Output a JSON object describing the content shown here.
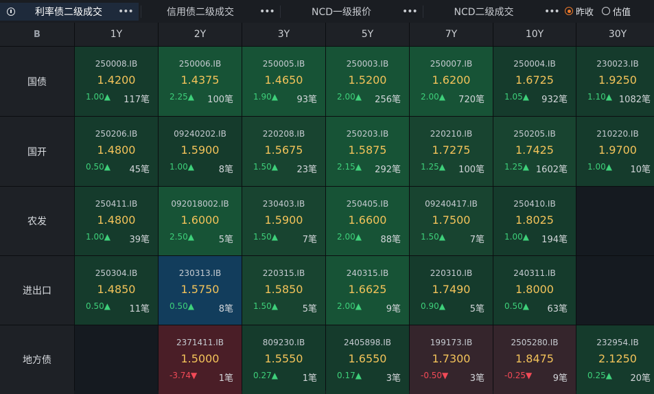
{
  "tabs": [
    {
      "label": "利率债二级成交",
      "active": true
    },
    {
      "label": "信用债二级成交",
      "active": false
    },
    {
      "label": "NCD一级报价",
      "active": false
    },
    {
      "label": "NCD二级成交",
      "active": false
    }
  ],
  "more_glyph": "•••",
  "radio": {
    "options": [
      {
        "label": "昨收",
        "checked": true
      },
      {
        "label": "估值",
        "checked": false
      }
    ]
  },
  "corner_icon": "B",
  "columns": [
    "1Y",
    "2Y",
    "3Y",
    "5Y",
    "7Y",
    "10Y",
    "30Y"
  ],
  "rows": [
    {
      "label": "国债",
      "cells": [
        {
          "code": "250008.IB",
          "yield": "1.4200",
          "change": "1.00▲",
          "dir": "up",
          "count": "117笔",
          "tone": "green-dark"
        },
        {
          "code": "250006.IB",
          "yield": "1.4375",
          "change": "2.25▲",
          "dir": "up",
          "count": "100笔",
          "tone": "green"
        },
        {
          "code": "250005.IB",
          "yield": "1.4650",
          "change": "1.90▲",
          "dir": "up",
          "count": "93笔",
          "tone": "green"
        },
        {
          "code": "250003.IB",
          "yield": "1.5200",
          "change": "2.00▲",
          "dir": "up",
          "count": "256笔",
          "tone": "green"
        },
        {
          "code": "250007.IB",
          "yield": "1.6200",
          "change": "2.00▲",
          "dir": "up",
          "count": "720笔",
          "tone": "green"
        },
        {
          "code": "250004.IB",
          "yield": "1.6725",
          "change": "1.05▲",
          "dir": "up",
          "count": "932笔",
          "tone": "green-dark"
        },
        {
          "code": "230023.IB",
          "yield": "1.9250",
          "change": "1.10▲",
          "dir": "up",
          "count": "1082笔",
          "tone": "green-dark"
        }
      ]
    },
    {
      "label": "国开",
      "cells": [
        {
          "code": "250206.IB",
          "yield": "1.4800",
          "change": "0.50▲",
          "dir": "up",
          "count": "45笔",
          "tone": "green-dark"
        },
        {
          "code": "09240202.IB",
          "yield": "1.5900",
          "change": "1.00▲",
          "dir": "up",
          "count": "8笔",
          "tone": "green-dark"
        },
        {
          "code": "220208.IB",
          "yield": "1.5675",
          "change": "1.50▲",
          "dir": "up",
          "count": "23笔",
          "tone": "green-mid"
        },
        {
          "code": "250203.IB",
          "yield": "1.5875",
          "change": "2.15▲",
          "dir": "up",
          "count": "292笔",
          "tone": "green"
        },
        {
          "code": "220210.IB",
          "yield": "1.7275",
          "change": "1.25▲",
          "dir": "up",
          "count": "100笔",
          "tone": "green-mid"
        },
        {
          "code": "250205.IB",
          "yield": "1.7425",
          "change": "1.25▲",
          "dir": "up",
          "count": "1602笔",
          "tone": "green-mid"
        },
        {
          "code": "210220.IB",
          "yield": "1.9700",
          "change": "1.00▲",
          "dir": "up",
          "count": "10笔",
          "tone": "green-dark"
        }
      ]
    },
    {
      "label": "农发",
      "cells": [
        {
          "code": "250411.IB",
          "yield": "1.4800",
          "change": "1.00▲",
          "dir": "up",
          "count": "39笔",
          "tone": "green-dark"
        },
        {
          "code": "092018002.IB",
          "yield": "1.6000",
          "change": "2.50▲",
          "dir": "up",
          "count": "5笔",
          "tone": "green"
        },
        {
          "code": "230403.IB",
          "yield": "1.5900",
          "change": "1.50▲",
          "dir": "up",
          "count": "7笔",
          "tone": "green-mid"
        },
        {
          "code": "250405.IB",
          "yield": "1.6600",
          "change": "2.00▲",
          "dir": "up",
          "count": "88笔",
          "tone": "green"
        },
        {
          "code": "09240417.IB",
          "yield": "1.7500",
          "change": "1.50▲",
          "dir": "up",
          "count": "7笔",
          "tone": "green-mid"
        },
        {
          "code": "250410.IB",
          "yield": "1.8025",
          "change": "1.00▲",
          "dir": "up",
          "count": "194笔",
          "tone": "green-dark"
        },
        null
      ]
    },
    {
      "label": "进出口",
      "cells": [
        {
          "code": "250304.IB",
          "yield": "1.4850",
          "change": "0.50▲",
          "dir": "up",
          "count": "11笔",
          "tone": "green-dark"
        },
        {
          "code": "230313.IB",
          "yield": "1.5750",
          "change": "0.50▲",
          "dir": "up",
          "count": "8笔",
          "tone": "blue"
        },
        {
          "code": "220315.IB",
          "yield": "1.5850",
          "change": "1.50▲",
          "dir": "up",
          "count": "5笔",
          "tone": "green-mid"
        },
        {
          "code": "240315.IB",
          "yield": "1.6625",
          "change": "2.00▲",
          "dir": "up",
          "count": "9笔",
          "tone": "green"
        },
        {
          "code": "220310.IB",
          "yield": "1.7490",
          "change": "0.90▲",
          "dir": "up",
          "count": "5笔",
          "tone": "green-dark"
        },
        {
          "code": "240311.IB",
          "yield": "1.8000",
          "change": "0.50▲",
          "dir": "up",
          "count": "63笔",
          "tone": "green-dark"
        },
        null
      ]
    },
    {
      "label": "地方债",
      "cells": [
        null,
        {
          "code": "2371411.IB",
          "yield": "1.5000",
          "change": "-3.74▼",
          "dir": "down",
          "count": "1笔",
          "tone": "red"
        },
        {
          "code": "809230.IB",
          "yield": "1.5550",
          "change": "0.27▲",
          "dir": "up",
          "count": "1笔",
          "tone": "green-dark"
        },
        {
          "code": "2405898.IB",
          "yield": "1.6550",
          "change": "0.17▲",
          "dir": "up",
          "count": "3笔",
          "tone": "green-dark"
        },
        {
          "code": "199173.IB",
          "yield": "1.7300",
          "change": "-0.50▼",
          "dir": "down",
          "count": "3笔",
          "tone": "red-dim"
        },
        {
          "code": "2505280.IB",
          "yield": "1.8475",
          "change": "-0.25▼",
          "dir": "down",
          "count": "9笔",
          "tone": "red-dim"
        },
        {
          "code": "232954.IB",
          "yield": "2.1250",
          "change": "0.25▲",
          "dir": "up",
          "count": "20笔",
          "tone": "green-dark"
        }
      ]
    }
  ],
  "colors": {
    "yield": "#f3c35a",
    "up": "#3ed07a",
    "down": "#f24a57",
    "radio_accent": "#f07a2a"
  }
}
